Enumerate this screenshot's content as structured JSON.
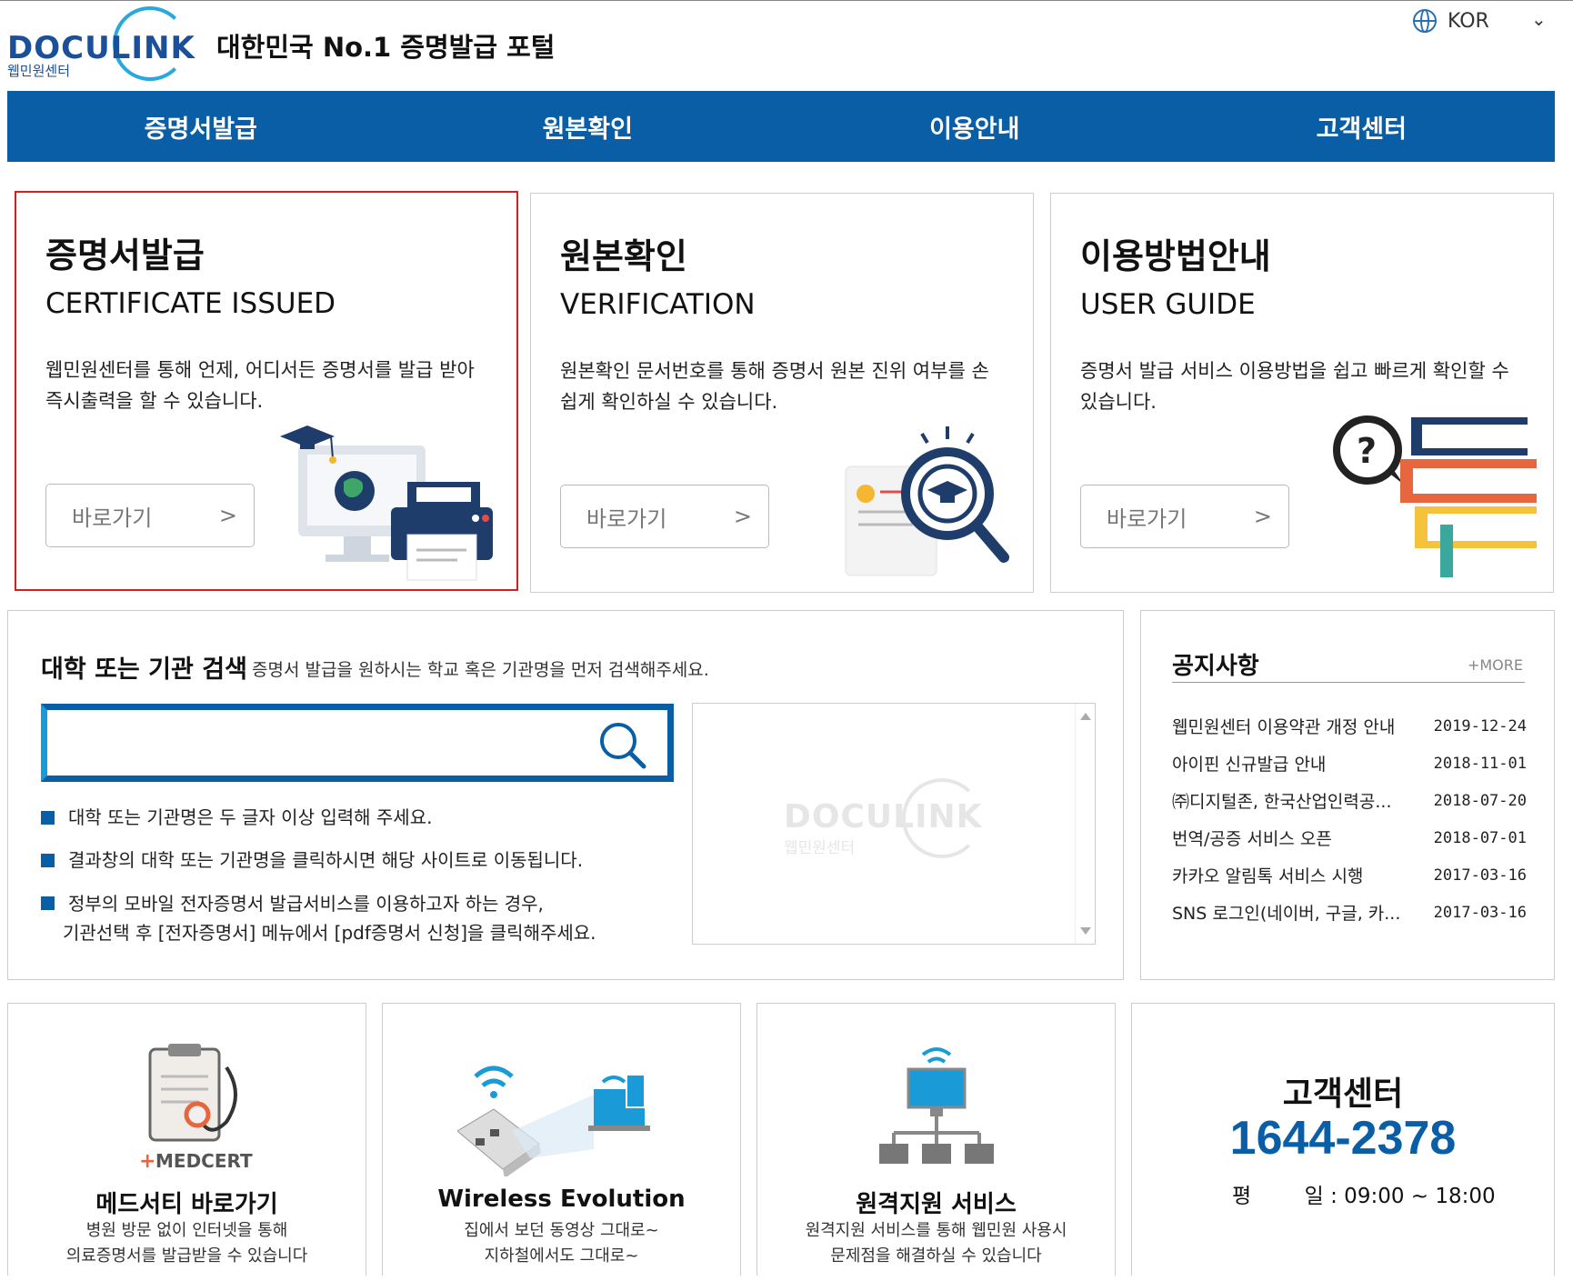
{
  "header": {
    "logo_text": "DOCULINK",
    "logo_sub": "웹민원센터",
    "tagline": "대한민국 No.1 증명발급 포털",
    "language": "KOR"
  },
  "nav": [
    "증명서발급",
    "원본확인",
    "이용안내",
    "고객센터"
  ],
  "cards": [
    {
      "title": "증명서발급",
      "subtitle": "CERTIFICATE ISSUED",
      "desc": "웹민원센터를 통해 언제, 어디서든 증명서를 발급 받아 즉시출력을 할 수 있습니다.",
      "button": "바로가기",
      "arrow": ">"
    },
    {
      "title": "원본확인",
      "subtitle": "VERIFICATION",
      "desc": "원본확인 문서번호를 통해 증명서 원본 진위 여부를 손쉽게 확인하실 수 있습니다.",
      "button": "바로가기",
      "arrow": ">"
    },
    {
      "title": "이용방법안내",
      "subtitle": "USER GUIDE",
      "desc": "증명서 발급 서비스 이용방법을 쉽고 빠르게 확인할 수 있습니다.",
      "button": "바로가기",
      "arrow": ">"
    }
  ],
  "search": {
    "title": "대학 또는 기관 검색",
    "desc": "증명서 발급을 원하시는 학교 혹은 기관명을 먼저 검색해주세요.",
    "value": "",
    "watermark_text": "DOCULINK",
    "watermark_sub": "웹민원센터",
    "tips": [
      "대학 또는 기관명은 두 글자 이상 입력해 주세요.",
      "결과창의 대학 또는 기관명을 클릭하시면 해당 사이트로 이동됩니다.",
      "정부의 모바일 전자증명서 발급서비스를 이용하고자 하는 경우,",
      "기관선택 후 [전자증명서] 메뉴에서 [pdf증명서 신청]을 클릭해주세요."
    ]
  },
  "notice": {
    "title": "공지사항",
    "more": "+MORE",
    "items": [
      {
        "title": "웹민원센터 이용약관 개정 안내",
        "date": "2019-12-24"
      },
      {
        "title": "아이핀 신규발급 안내",
        "date": "2018-11-01"
      },
      {
        "title": "㈜디지털존, 한국산업인력공...",
        "date": "2018-07-20"
      },
      {
        "title": "번역/공증 서비스 오픈",
        "date": "2018-07-01"
      },
      {
        "title": "카카오 알림톡 서비스 시행",
        "date": "2017-03-16"
      },
      {
        "title": "SNS 로그인(네이버, 구글, 카...",
        "date": "2017-03-16"
      }
    ]
  },
  "bottom": [
    {
      "logo": "MEDCERTI",
      "title": "메드서티 바로가기",
      "desc1": "병원 방문 없이 인터넷을 통해",
      "desc2": "의료증명서를 발급받을 수 있습니다"
    },
    {
      "title": "Wireless Evolution",
      "desc1": "집에서 보던 동영상 그대로~",
      "desc2": "지하철에서도 그대로~"
    },
    {
      "title": "원격지원 서비스",
      "desc1": "원격지원 서비스를 통해 웹민원 사용시",
      "desc2": "문제점을 해결하실 수 있습니다"
    }
  ],
  "customer": {
    "title": "고객센터",
    "phone": "1644-2378",
    "hours": "평        일 : 09:00 ~ 18:00"
  },
  "colors": {
    "brand": "#0a5ea5",
    "accent": "#29a8e0",
    "highlight": "#e01b1b"
  }
}
